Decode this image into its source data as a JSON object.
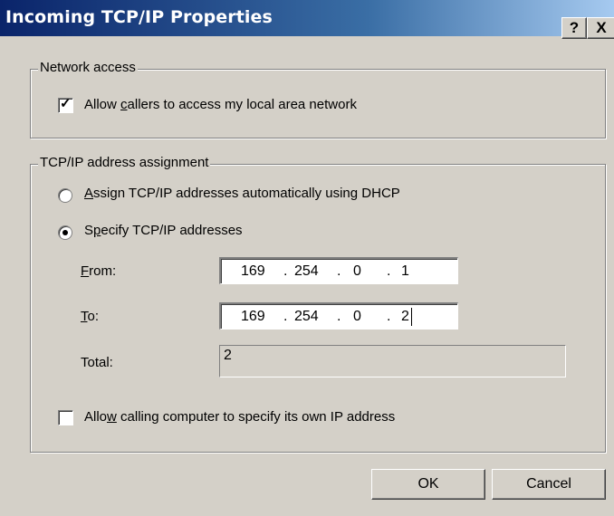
{
  "window": {
    "title": "Incoming TCP/IP Properties",
    "help_glyph": "?",
    "close_glyph": "X"
  },
  "network_access": {
    "legend": "Network access",
    "allow_lan": {
      "pre": "Allow ",
      "accel": "c",
      "post": "allers to access my local area network",
      "checked": true
    }
  },
  "tcpip": {
    "legend": "TCP/IP address assignment",
    "dhcp": {
      "pre": "",
      "accel": "A",
      "post": "ssign TCP/IP addresses automatically using DHCP",
      "selected": false
    },
    "specify": {
      "pre": "S",
      "accel": "p",
      "post": "ecify TCP/IP addresses",
      "selected": true
    },
    "from": {
      "accel": "F",
      "post": "rom:",
      "octets": [
        "169",
        "254",
        "0",
        "1"
      ]
    },
    "to": {
      "accel": "T",
      "post": "o:",
      "octets": [
        "169",
        "254",
        "0",
        "2"
      ]
    },
    "total": {
      "label": "Total:",
      "value": "2"
    },
    "allow_own_ip": {
      "pre": "Allo",
      "accel": "w",
      "post": " calling computer to specify its own IP address",
      "checked": false
    }
  },
  "buttons": {
    "ok": "OK",
    "cancel": "Cancel"
  },
  "colors": {
    "face": "#d4d0c8",
    "title_start": "#0a246a",
    "title_end": "#a6caf0"
  }
}
